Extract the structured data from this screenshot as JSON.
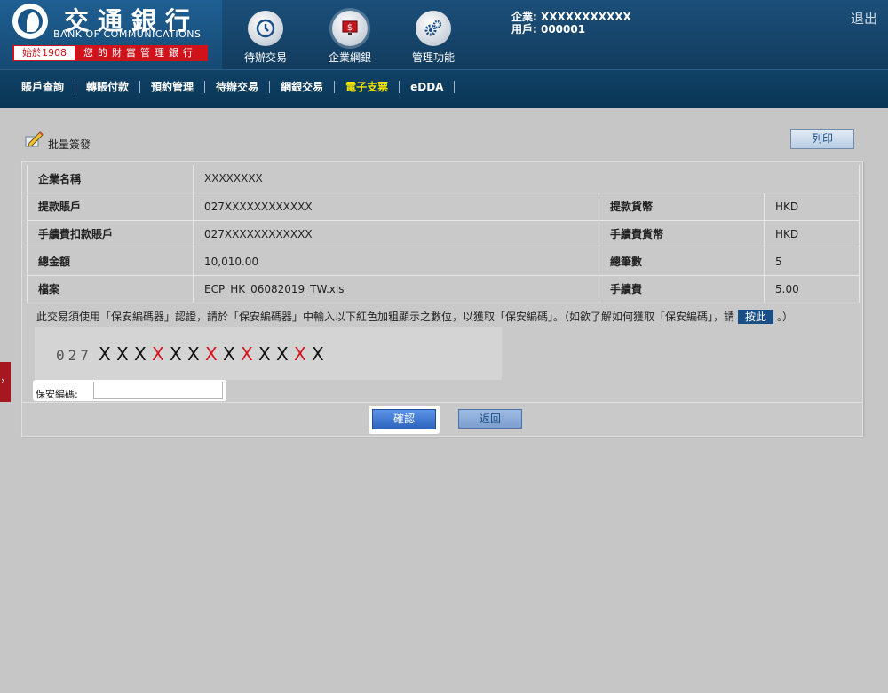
{
  "brand": {
    "name_cn": "交通銀行",
    "name_en": "BANK OF COMMUNICATIONS",
    "since": "始於1908",
    "slogan": "您的財富管理銀行"
  },
  "header_nav": [
    {
      "label": "待辦交易",
      "icon": "clock-icon"
    },
    {
      "label": "企業網銀",
      "icon": "dollar-monitor-icon"
    },
    {
      "label": "管理功能",
      "icon": "gears-icon"
    }
  ],
  "user": {
    "company_line": "企業: XXXXXXXXXXX",
    "user_line": "用戶: 000001"
  },
  "logout_label": "退出",
  "menu": [
    "賬戶查詢",
    "轉賬付款",
    "預約管理",
    "待辦交易",
    "網銀交易",
    "電子支票",
    "eDDA"
  ],
  "menu_active": "電子支票",
  "page": {
    "title": "批量簽發",
    "print_label": "列印"
  },
  "info": {
    "company_label": "企業名稱",
    "company_value": "XXXXXXXX",
    "rows": [
      {
        "l1": "提款賬戶",
        "v1": "027XXXXXXXXXXXX",
        "l2": "提款貨幣",
        "v2": "HKD"
      },
      {
        "l1": "手續費扣款賬戶",
        "v1": "027XXXXXXXXXXXX",
        "l2": "手續費貨幣",
        "v2": "HKD"
      },
      {
        "l1": "總金額",
        "v1": "10,010.00",
        "l2": "總筆數",
        "v2": "5"
      },
      {
        "l1": "檔案",
        "v1": "ECP_HK_06082019_TW.xls",
        "l2": "手續費",
        "v2": "5.00"
      }
    ]
  },
  "security": {
    "note_before": "此交易須使用「保安編碼器」認證，請於「保安編碼器」中輸入以下紅色加粗顯示之數位，以獲取「保安編碼」。（如欲了解如何獲取「保安編碼」，請",
    "link_label": "按此",
    "note_after": "。）",
    "code_prefix": "027",
    "code_chars": [
      "X",
      "X",
      "X",
      "X",
      "X",
      "X",
      "X",
      "X",
      "X",
      "X",
      "X",
      "X",
      "X"
    ],
    "code_highlight": [
      false,
      false,
      false,
      true,
      false,
      false,
      true,
      false,
      true,
      false,
      false,
      true,
      false
    ],
    "highlight_color": "#d6141d",
    "pin_label": "保安編碼:",
    "pin_value": ""
  },
  "buttons": {
    "confirm": "確認",
    "back": "返回"
  },
  "side_tab_glyph": "›"
}
